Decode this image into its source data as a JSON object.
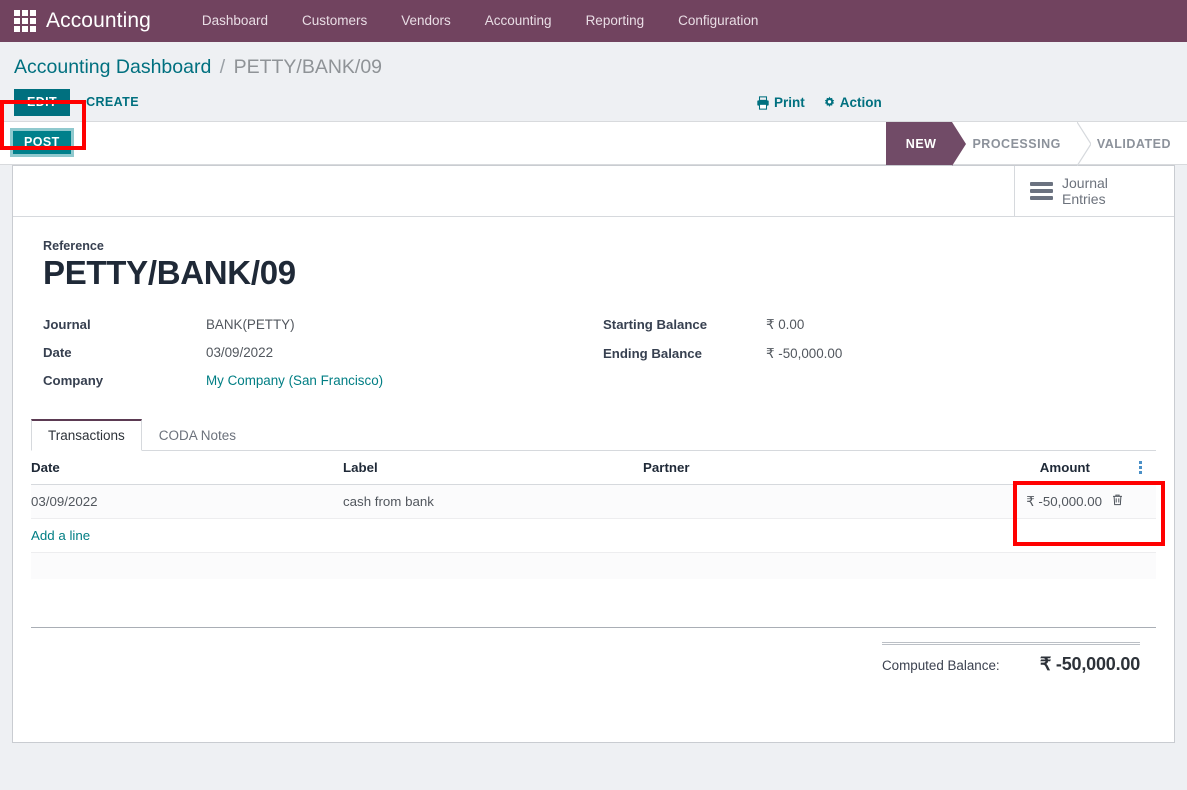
{
  "navbar": {
    "apps_icon": "apps-grid-icon",
    "brand": "Accounting",
    "menu": [
      {
        "label": "Dashboard"
      },
      {
        "label": "Customers"
      },
      {
        "label": "Vendors"
      },
      {
        "label": "Accounting"
      },
      {
        "label": "Reporting"
      },
      {
        "label": "Configuration"
      }
    ]
  },
  "breadcrumb": {
    "root": "Accounting Dashboard",
    "separator": "/",
    "current": "PETTY/BANK/09"
  },
  "control_panel": {
    "edit_label": "EDIT",
    "create_label": "CREATE",
    "print_label": "Print",
    "print_icon": "printer-icon",
    "action_label": "Action",
    "action_icon": "gear-icon"
  },
  "statusbar": {
    "post_label": "POST",
    "steps": [
      {
        "label": "NEW",
        "active": true
      },
      {
        "label": "PROCESSING",
        "active": false
      },
      {
        "label": "VALIDATED",
        "active": false
      }
    ]
  },
  "stat_button": {
    "icon": "bars-icon",
    "line1": "Journal",
    "line2": "Entries"
  },
  "form": {
    "reference_label": "Reference",
    "reference_value": "PETTY/BANK/09",
    "left_fields": [
      {
        "label": "Journal",
        "value": "BANK(PETTY)",
        "link": false
      },
      {
        "label": "Date",
        "value": "03/09/2022",
        "link": false
      },
      {
        "label": "Company",
        "value": "My Company (San Francisco)",
        "link": true
      }
    ],
    "right_fields": [
      {
        "label": "Starting Balance",
        "value": "₹ 0.00",
        "link": false
      },
      {
        "label": "Ending Balance",
        "value": "₹ -50,000.00",
        "link": false
      }
    ]
  },
  "notebook": {
    "tabs": [
      {
        "label": "Transactions",
        "active": true
      },
      {
        "label": "CODA Notes",
        "active": false
      }
    ]
  },
  "lines_table": {
    "columns": [
      "Date",
      "Label",
      "Partner",
      "Amount"
    ],
    "options_icon": "column-options-icon",
    "rows": [
      {
        "date": "03/09/2022",
        "label": "cash from bank",
        "partner": "",
        "amount": "₹ -50,000.00",
        "delete_icon": "trash-icon"
      }
    ],
    "add_line_label": "Add a line"
  },
  "totals": {
    "label": "Computed Balance:",
    "value": "₹ -50,000.00"
  },
  "colors": {
    "navbar_purple": "#71435f",
    "status_active_purple": "#714b67",
    "accent_teal": "#00707f",
    "post_teal": "#00808b",
    "highlight_red": "#ff0000"
  }
}
